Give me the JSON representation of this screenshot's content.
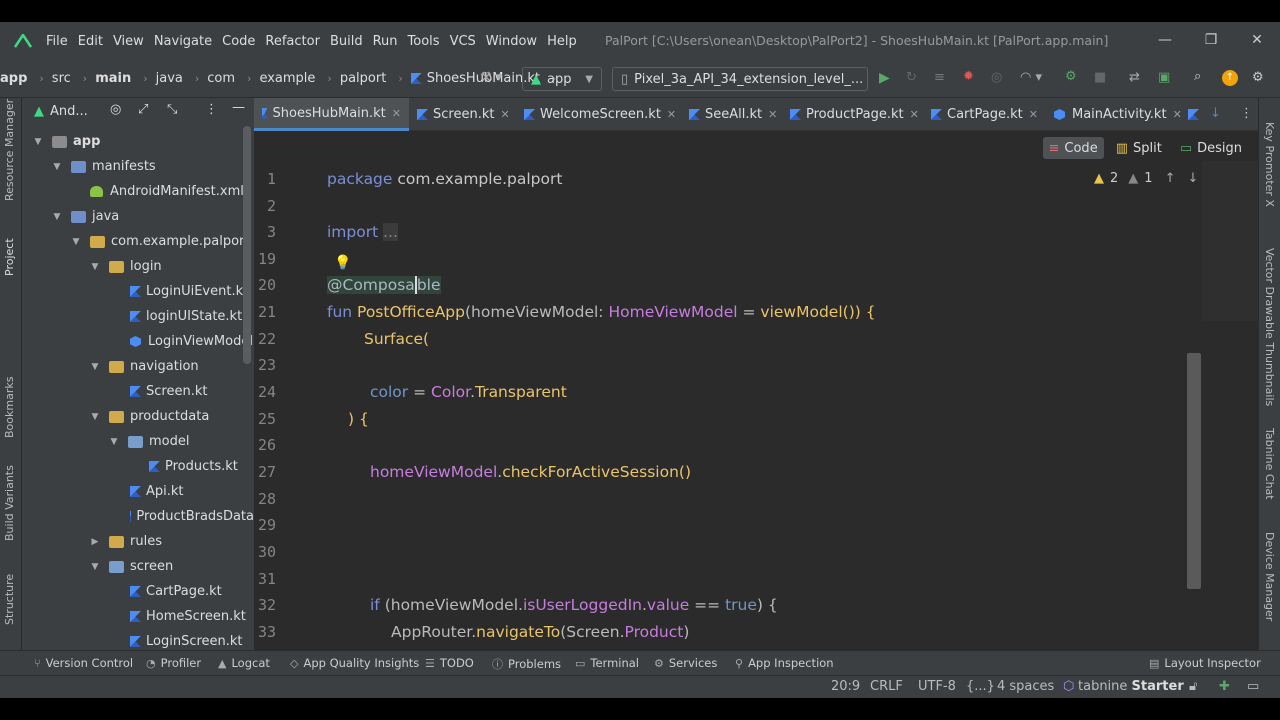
{
  "window": {
    "title": "PalPort [C:\\Users\\onean\\Desktop\\PalPort2] - ShoesHubMain.kt [PalPort.app.main]",
    "minimize": "—",
    "restore": "❐",
    "close": "✕"
  },
  "menu": [
    "File",
    "Edit",
    "View",
    "Navigate",
    "Code",
    "Refactor",
    "Build",
    "Run",
    "Tools",
    "VCS",
    "Window",
    "Help"
  ],
  "breadcrumb": [
    "app",
    "src",
    "main",
    "java",
    "com",
    "example",
    "palport",
    "ShoesHubMain.kt"
  ],
  "toolbar": {
    "run_config": "app",
    "device": "Pixel_3a_API_34_extension_level_..."
  },
  "project_panel": {
    "title": "And...",
    "tree": [
      {
        "label": "app",
        "depth": 0,
        "expanded": true,
        "icon": "module-folder-icon"
      },
      {
        "label": "manifests",
        "depth": 1,
        "expanded": true,
        "icon": "folder-icon"
      },
      {
        "label": "AndroidManifest.xml",
        "depth": 2,
        "icon": "android-manifest-icon"
      },
      {
        "label": "java",
        "depth": 1,
        "expanded": true,
        "icon": "folder-icon"
      },
      {
        "label": "com.example.palport",
        "depth": 2,
        "expanded": true,
        "icon": "package-icon"
      },
      {
        "label": "login",
        "depth": 3,
        "expanded": true,
        "icon": "package-icon"
      },
      {
        "label": "LoginUiEvent.kt",
        "depth": 4,
        "icon": "kotlin-file-icon"
      },
      {
        "label": "loginUIState.kt",
        "depth": 4,
        "icon": "kotlin-file-icon"
      },
      {
        "label": "LoginViewModel",
        "depth": 4,
        "icon": "kotlin-class-icon"
      },
      {
        "label": "navigation",
        "depth": 3,
        "expanded": true,
        "icon": "package-icon"
      },
      {
        "label": "Screen.kt",
        "depth": 4,
        "icon": "kotlin-file-icon"
      },
      {
        "label": "productdata",
        "depth": 3,
        "expanded": true,
        "icon": "package-icon"
      },
      {
        "label": "model",
        "depth": 4,
        "expanded": true,
        "icon": "package-icon"
      },
      {
        "label": "Products.kt",
        "depth": 5,
        "icon": "kotlin-file-icon"
      },
      {
        "label": "Api.kt",
        "depth": 4,
        "icon": "kotlin-file-icon"
      },
      {
        "label": "ProductBradsData",
        "depth": 4,
        "icon": "kotlin-file-icon"
      },
      {
        "label": "rules",
        "depth": 3,
        "expanded": false,
        "icon": "package-icon"
      },
      {
        "label": "screen",
        "depth": 3,
        "expanded": true,
        "icon": "package-icon"
      },
      {
        "label": "CartPage.kt",
        "depth": 4,
        "icon": "kotlin-file-icon"
      },
      {
        "label": "HomeScreen.kt",
        "depth": 4,
        "icon": "kotlin-file-icon"
      },
      {
        "label": "LoginScreen.kt",
        "depth": 4,
        "icon": "kotlin-file-icon"
      }
    ]
  },
  "left_strip": [
    "Resource Manager",
    "Project",
    "Bookmarks",
    "Build Variants",
    "Structure"
  ],
  "right_strip": [
    "Key Promoter X",
    "Vector Drawable Thumbnails",
    "Tabnine Chat",
    "Device Manager"
  ],
  "editor_tabs": [
    "ShoesHubMain.kt",
    "Screen.kt",
    "WelcomeScreen.kt",
    "SeeAll.kt",
    "ProductPage.kt",
    "CartPage.kt",
    "MainActivity.kt"
  ],
  "view_modes": {
    "code": "Code",
    "split": "Split",
    "design": "Design"
  },
  "inspections": {
    "warnings": "2",
    "weak": "1"
  },
  "code": {
    "line_numbers": [
      "1",
      "2",
      "3",
      "19",
      "20",
      "21",
      "22",
      "23",
      "24",
      "25",
      "26",
      "27",
      "28",
      "29",
      "30",
      "31",
      "32",
      "33"
    ],
    "l1_kw": "package",
    "l1_rest": " com.example.palport",
    "l3_kw": "import",
    "l3_fold": "...",
    "l20_a": "@Composa",
    "l20_b": "ble",
    "l21_kw": "fun ",
    "l21_fn": "PostOfficeApp",
    "l21_p1": "(homeViewModel: ",
    "l21_type": "HomeViewModel",
    "l21_p2": " = ",
    "l21_call": "viewModel",
    "l21_p3": "()) {",
    "l22_fn": "Surface(",
    "l24_named": "color",
    "l24_eq": " = ",
    "l24_type": "Color",
    "l24_dot": ".",
    "l24_val": "Transparent",
    "l25": ") {",
    "l27_obj": "homeViewModel",
    "l27_dot": ".",
    "l27_call": "checkForActiveSession",
    "l27_end": "()",
    "l32_kw": "if ",
    "l32_a": "(homeViewModel.",
    "l32_prop": "isUserLoggedIn",
    "l32_b": ".",
    "l32_val": "value",
    "l32_op": " == ",
    "l32_bool": "true",
    "l32_c": ") {",
    "l33_a": "AppRouter.",
    "l33_call": "navigateTo",
    "l33_b": "(Screen.",
    "l33_c": "Product",
    "l33_d": ")"
  },
  "tool_tabs": [
    "Version Control",
    "Profiler",
    "Logcat",
    "App Quality Insights",
    "TODO",
    "Problems",
    "Terminal",
    "Services",
    "App Inspection",
    "Layout Inspector"
  ],
  "status": {
    "position": "20:9",
    "line_sep": "CRLF",
    "encoding": "UTF-8",
    "braces": "{...}",
    "indent": "4 spaces",
    "tabnine_brand": "tabnine",
    "tabnine_plan": "Starter"
  },
  "colors": {
    "accent": "#4a88c7",
    "bg_editor": "#2b2b2b",
    "bg_chrome": "#3c3f41"
  }
}
